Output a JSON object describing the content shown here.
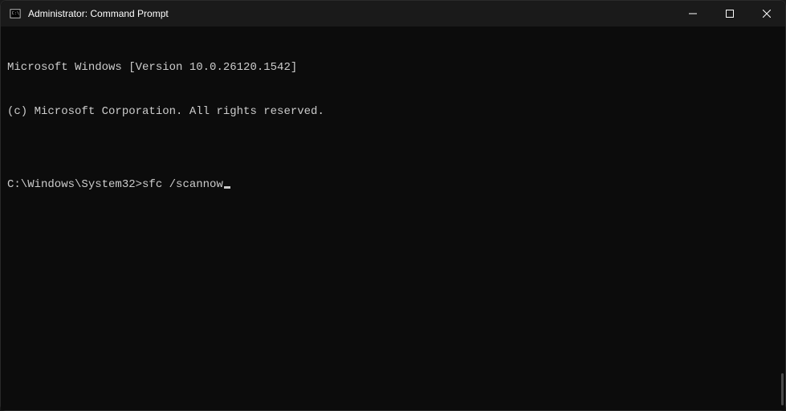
{
  "window": {
    "title": "Administrator: Command Prompt"
  },
  "terminal": {
    "line1": "Microsoft Windows [Version 10.0.26120.1542]",
    "line2": "(c) Microsoft Corporation. All rights reserved.",
    "blank": "",
    "prompt": "C:\\Windows\\System32>",
    "command": "sfc /scannow"
  }
}
